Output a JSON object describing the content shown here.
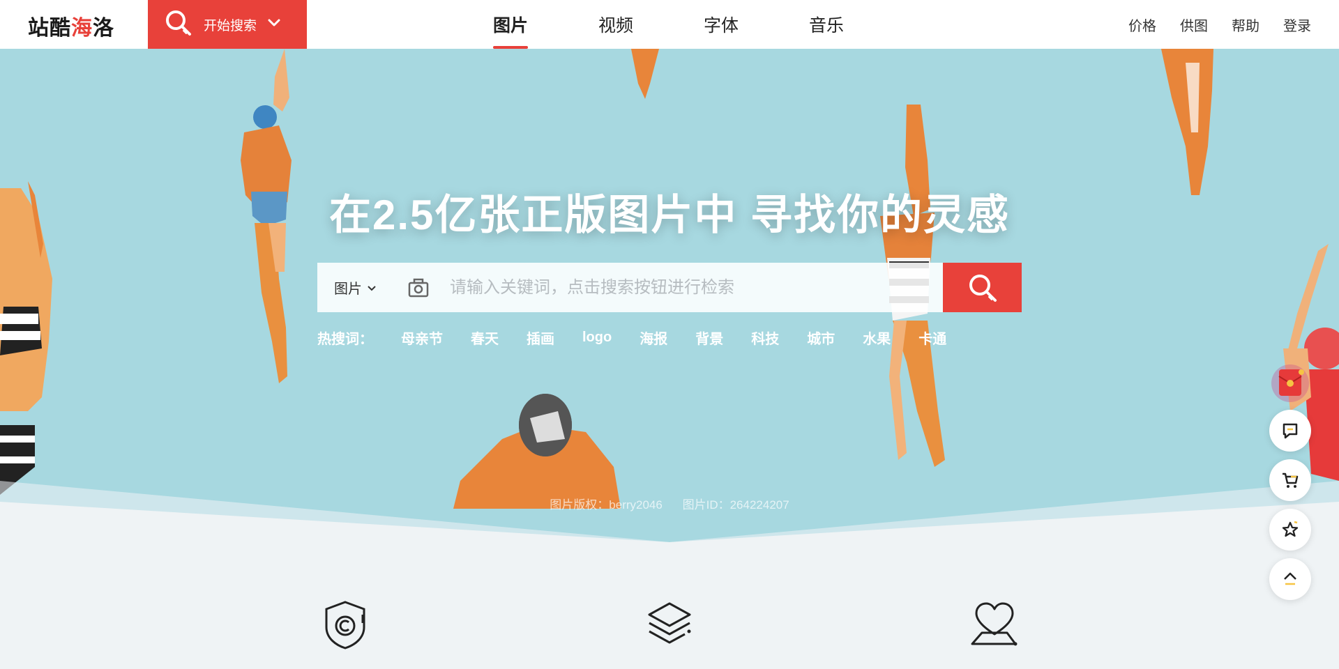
{
  "header": {
    "logo": {
      "part1": "站酷",
      "part2": "海",
      "part3": "洛"
    },
    "start_search": "开始搜索",
    "tabs": [
      {
        "label": "图片",
        "active": true
      },
      {
        "label": "视频",
        "active": false
      },
      {
        "label": "字体",
        "active": false
      },
      {
        "label": "音乐",
        "active": false
      }
    ],
    "links": [
      "价格",
      "供图",
      "帮助",
      "登录"
    ]
  },
  "hero": {
    "headline": "在2.5亿张正版图片中 寻找你的灵感",
    "search": {
      "type_selected": "图片",
      "placeholder": "请输入关键词，点击搜索按钮进行检索",
      "value": ""
    },
    "hot": {
      "label": "热搜词：",
      "keywords": [
        "母亲节",
        "春天",
        "插画",
        "logo",
        "海报",
        "背景",
        "科技",
        "城市",
        "水果",
        "卡通"
      ]
    },
    "credit": {
      "copyright": "图片版权：berry2046",
      "image_id": "图片ID：264224207"
    }
  },
  "features": {
    "icons": [
      "copyright-shield-icon",
      "layers-icon",
      "heart-hand-icon"
    ]
  },
  "side_tools": {
    "icons": [
      "red-envelope-icon",
      "message-icon",
      "cart-icon",
      "star-icon",
      "back-to-top-icon"
    ]
  },
  "colors": {
    "accent": "#e8413a",
    "hero_bg": "#a7d8e0",
    "page_bg": "#eff3f5"
  }
}
